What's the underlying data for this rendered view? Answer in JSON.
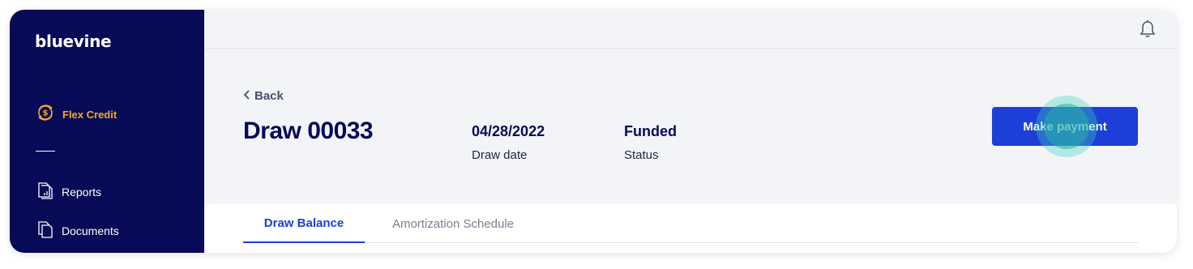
{
  "brand": {
    "logo": "bluevine"
  },
  "sidebar": {
    "flex_credit": {
      "label": "Flex Credit",
      "icon": "dollar-cycle-icon",
      "color": "#f6a72b"
    },
    "items": [
      {
        "label": "Reports",
        "icon": "report-chart-icon"
      },
      {
        "label": "Documents",
        "icon": "documents-icon"
      }
    ]
  },
  "topbar": {
    "notification_icon": "bell-icon"
  },
  "header": {
    "back_label": "Back",
    "title": "Draw 00033",
    "draw_date": {
      "value": "04/28/2022",
      "label": "Draw date"
    },
    "status": {
      "value": "Funded",
      "label": "Status"
    },
    "primary_action": "Make payment"
  },
  "tabs": [
    {
      "label": "Draw Balance",
      "active": true
    },
    {
      "label": "Amortization Schedule",
      "active": false
    }
  ],
  "colors": {
    "navy": "#070a56",
    "accent_blue": "#1d3fd8",
    "background": "#f2f4f8"
  }
}
